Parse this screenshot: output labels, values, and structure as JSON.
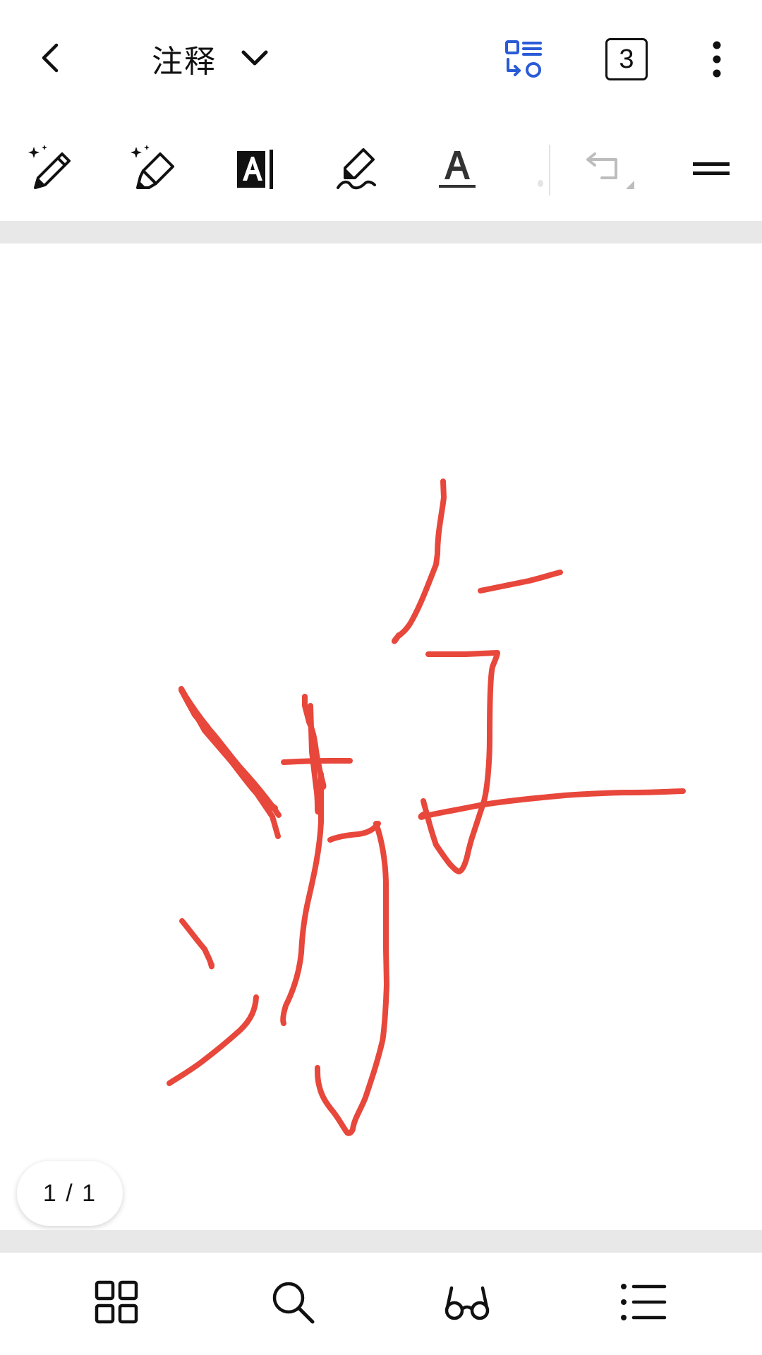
{
  "header": {
    "title": "注释",
    "page_count": "3"
  },
  "page_indicator": {
    "text": "1 / 1"
  },
  "colors": {
    "ink_stroke": "#E8473B",
    "accent_blue": "#2A5BD7",
    "icon_dark": "#111111",
    "icon_disabled": "#BDBDBD",
    "band_grey": "#E8E8E8"
  },
  "icons": {
    "back": "chevron-left-icon",
    "title_dropdown": "chevron-down-icon",
    "reflow": "reflow-view-icon",
    "more": "more-vertical-icon",
    "tools": [
      "ai-pen-icon",
      "ai-highlighter-icon",
      "text-box-icon",
      "signature-pen-icon",
      "text-color-icon",
      "undo-icon",
      "toolbar-collapse-icon"
    ],
    "bottom_nav": [
      "thumbnails-grid-icon",
      "search-icon",
      "read-mode-glasses-icon",
      "outline-list-icon"
    ]
  }
}
